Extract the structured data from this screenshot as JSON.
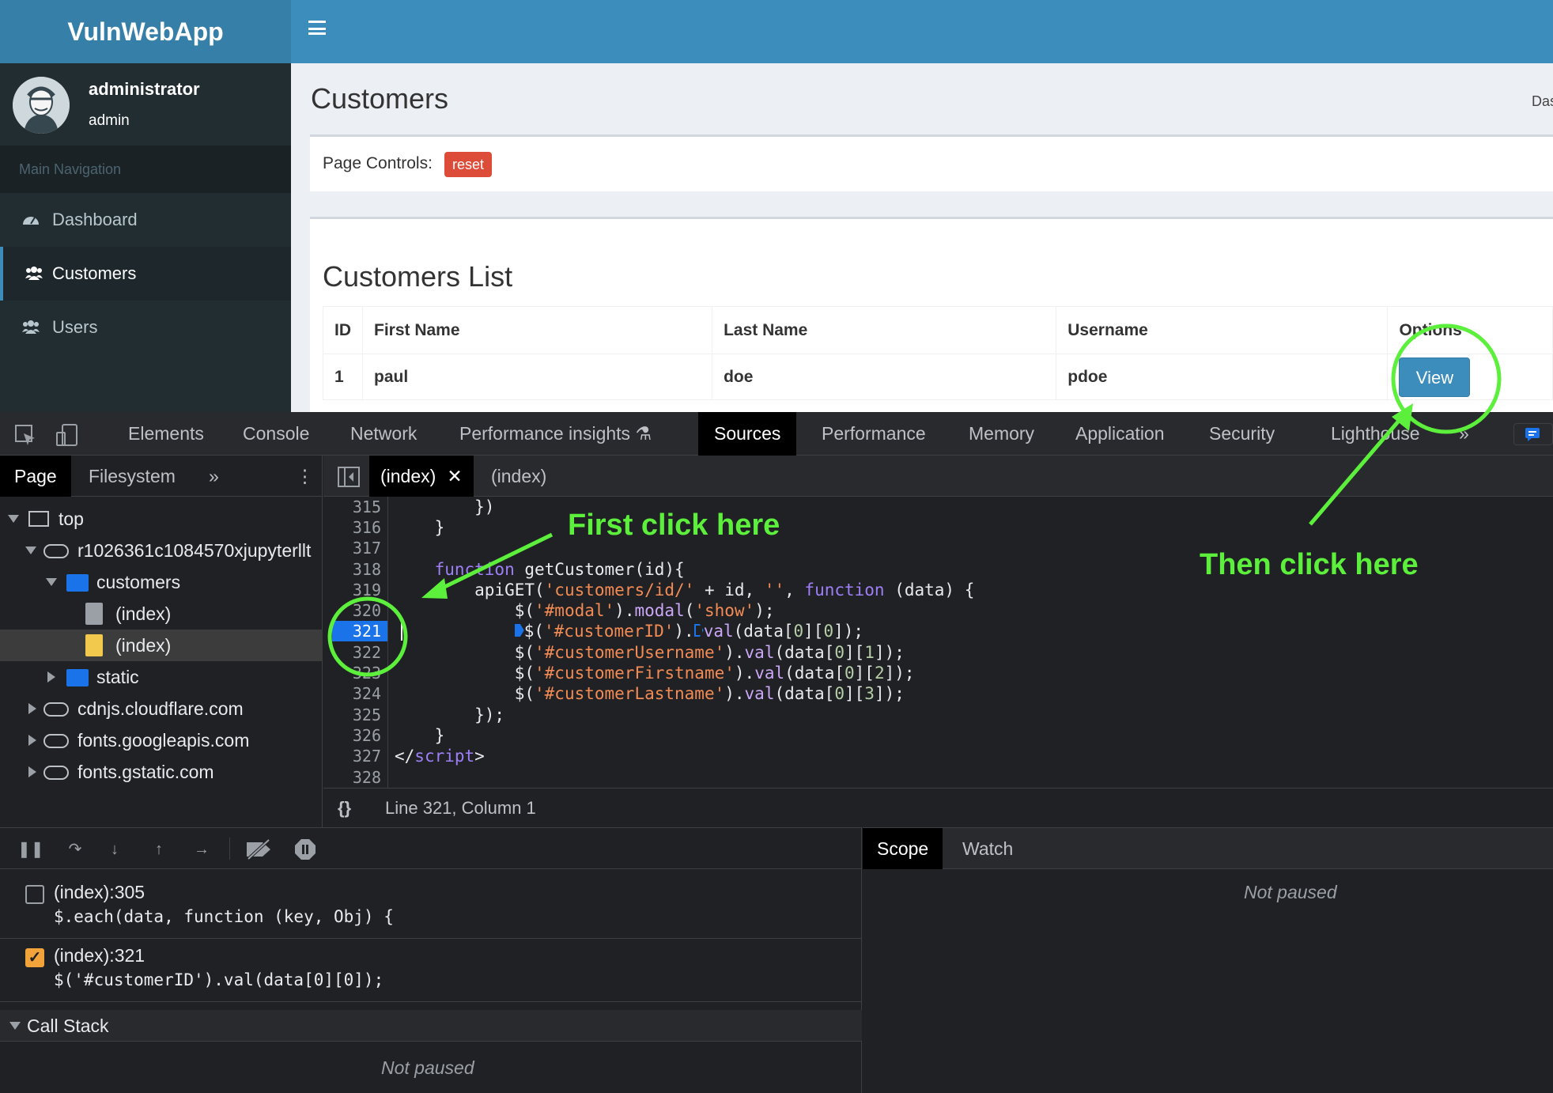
{
  "app": {
    "logo": "VulnWebApp",
    "user": {
      "name": "administrator",
      "role": "admin"
    },
    "nav_header": "Main Navigation",
    "nav": [
      {
        "label": "Dashboard",
        "icon": "dashboard-icon"
      },
      {
        "label": "Customers",
        "icon": "users-icon"
      },
      {
        "label": "Users",
        "icon": "users-icon"
      }
    ],
    "page_title": "Customers",
    "breadcrumb_partial": "Das",
    "page_controls_label": "Page Controls:",
    "reset_label": "reset",
    "list_title": "Customers List",
    "table": {
      "headers": [
        "ID",
        "First Name",
        "Last Name",
        "Username",
        "Options"
      ],
      "rows": [
        {
          "id": "1",
          "first": "paul",
          "last": "doe",
          "username": "pdoe",
          "option": "View"
        }
      ]
    },
    "colors": {
      "brand": "#3c8dbc",
      "sidebar": "#222d32",
      "reset": "#dd4b39"
    }
  },
  "devtools": {
    "tabs": [
      "Elements",
      "Console",
      "Network",
      "Performance insights",
      "Sources",
      "Performance",
      "Memory",
      "Application",
      "Security",
      "Lighthouse"
    ],
    "active_tab": "Sources",
    "sidebar_tabs": [
      "Page",
      "Filesystem"
    ],
    "tree": [
      "top",
      "r1026361c1084570xjupyterllt",
      "customers",
      "(index)",
      "(index)",
      "static",
      "cdnjs.cloudflare.com",
      "fonts.googleapis.com",
      "fonts.gstatic.com"
    ],
    "editor_tabs": [
      "(index)",
      "(index)"
    ],
    "line_numbers": [
      "315",
      "316",
      "317",
      "318",
      "319",
      "320",
      "321",
      "322",
      "323",
      "324",
      "325",
      "326",
      "327",
      "328"
    ],
    "breakpoint_line": "321",
    "code": {
      "l315": "        })",
      "l316": "    }",
      "l318_kw": "function",
      "l318_rest": " getCustomer(id){",
      "l319_a": "        apiGET(",
      "l319_s1": "'customers/id/'",
      "l319_b": " + id, ",
      "l319_s2": "''",
      "l319_c": ", ",
      "l319_kw": "function",
      "l319_d": " (data) {",
      "l320_a": "            $(",
      "l320_s1": "'#modal'",
      "l320_b": ").",
      "l320_f": "modal",
      "l320_c": "(",
      "l320_s2": "'show'",
      "l320_d": ");",
      "l321_a": "$(",
      "l321_s": "'#customerID'",
      "l321_b": ").",
      "l321_f": "val",
      "l321_c": "(data[",
      "l321_n1": "0",
      "l321_d": "][",
      "l321_n2": "0",
      "l321_e": "]);",
      "l322_s": "'#customerUsername'",
      "l322_n": "1",
      "l323_s": "'#customerFirstname'",
      "l323_n": "2",
      "l324_s": "'#customerLastname'",
      "l324_n": "3",
      "l325": "        });",
      "l326": "    }",
      "l327_a": "</",
      "l327_t": "script",
      "l327_b": ">",
      "prefix": "            $(",
      "mid": ").",
      "val": "val",
      "open": "(data[",
      "zero": "0",
      "sep": "][",
      "close": "]);"
    },
    "status": "Line 321, Column 1",
    "breakpoints": [
      {
        "loc": "(index):305",
        "code": "$.each(data, function (key, Obj) {",
        "checked": false
      },
      {
        "loc": "(index):321",
        "code": "$('#customerID').val(data[0][0]);",
        "checked": true
      }
    ],
    "call_stack_label": "Call Stack",
    "not_paused": "Not paused",
    "scope_tabs": [
      "Scope",
      "Watch"
    ]
  },
  "annotations": {
    "first": "First click here",
    "then": "Then click here",
    "color": "#5cf03c"
  }
}
